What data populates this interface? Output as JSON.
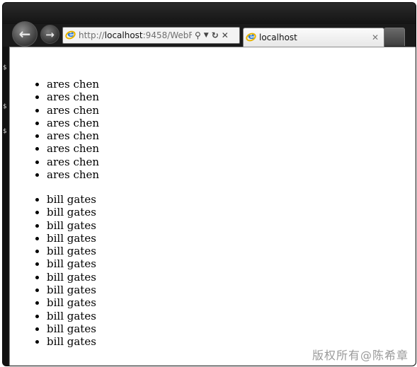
{
  "browser": {
    "address": {
      "url_prefix": "http://",
      "url_host": "localhost",
      "url_suffix": ":9458/WebFor"
    },
    "tabs": [
      {
        "label": "localhost",
        "active": true
      }
    ]
  },
  "page": {
    "list_a": [
      "ares chen",
      "ares chen",
      "ares chen",
      "ares chen",
      "ares chen",
      "ares chen",
      "ares chen",
      "ares chen"
    ],
    "list_b": [
      "bill gates",
      "bill gates",
      "bill gates",
      "bill gates",
      "bill gates",
      "bill gates",
      "bill gates",
      "bill gates",
      "bill gates",
      "bill gates",
      "bill gates",
      "bill gates"
    ]
  },
  "watermark": "版权所有@陈希章",
  "icons": {
    "back": "back-arrow-icon",
    "forward": "forward-arrow-icon",
    "search": "search-icon",
    "dropdown": "chevron-down-icon",
    "refresh": "refresh-icon",
    "stop": "stop-icon",
    "tab_close": "close-icon",
    "ie": "internet-explorer-icon"
  },
  "colors": {
    "chrome": "#1a1a1a",
    "address_bg": "#f3f3f3",
    "tab_bg": "#f0f0f0",
    "content_bg": "#ffffff"
  }
}
